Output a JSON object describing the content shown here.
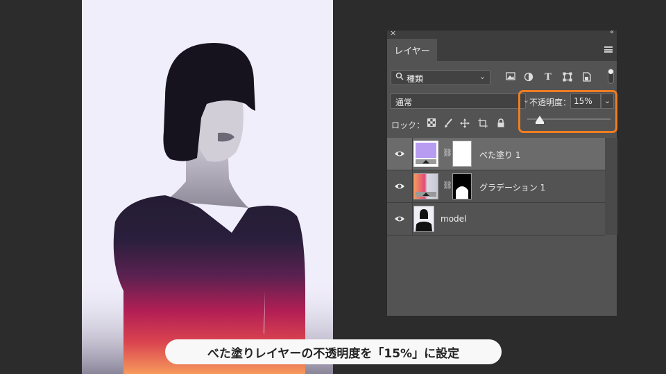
{
  "panel": {
    "close_glyph": "×",
    "collapse_glyph": "‹‹",
    "tab_label": "レイヤー",
    "menu_icon": "hamburger-menu-icon",
    "filter": {
      "value": "種類",
      "icon": "search-icon"
    },
    "filter_icons": [
      "image-filter-icon",
      "adjustment-filter-icon",
      "text-filter-icon",
      "shape-filter-icon",
      "smart-object-filter-icon"
    ],
    "blend_mode": "通常",
    "opacity_label": "不透明度：",
    "opacity_value": "15%",
    "opacity_fraction": 0.15,
    "lock_label": "ロック：",
    "lock_icons": [
      "lock-transparent-icon",
      "lock-paint-icon",
      "lock-position-icon",
      "lock-artboard-icon",
      "lock-all-icon"
    ],
    "layers": [
      {
        "name": "べた塗り 1",
        "selected": true,
        "visible": true,
        "type": "fill",
        "thumb_color": "#b79cf2"
      },
      {
        "name": "グラデーション 1",
        "selected": false,
        "visible": true,
        "type": "gradient"
      },
      {
        "name": "model",
        "selected": false,
        "visible": true,
        "type": "image"
      }
    ]
  },
  "highlight_color": "#ef7d22",
  "caption": "べた塗りレイヤーの不透明度を「15%」に設定"
}
